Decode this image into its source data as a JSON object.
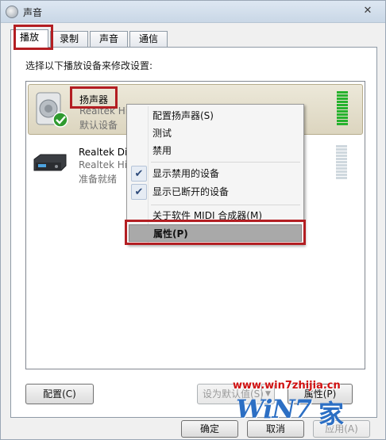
{
  "window": {
    "title": "声音",
    "close_glyph": "✕"
  },
  "tabs": [
    {
      "label": "播放",
      "active": true
    },
    {
      "label": "录制",
      "active": false
    },
    {
      "label": "声音",
      "active": false
    },
    {
      "label": "通信",
      "active": false
    }
  ],
  "instruction": "选择以下播放设备来修改设置:",
  "devices": [
    {
      "name": "扬声器",
      "sub": "Realtek Hi",
      "status": "默认设备",
      "selected": true,
      "icon": "speaker-icon",
      "badge": "default-check-icon",
      "meter": "level-meter"
    },
    {
      "name": "Realtek Di",
      "sub": "Realtek Hi",
      "status": "准备就绪",
      "selected": false,
      "icon": "digital-output-icon"
    }
  ],
  "context_menu": {
    "items": [
      {
        "label": "配置扬声器(S)",
        "checked": false
      },
      {
        "label": "测试",
        "checked": false
      },
      {
        "label": "禁用",
        "checked": false
      },
      {
        "label": "显示禁用的设备",
        "checked": true
      },
      {
        "label": "显示已断开的设备",
        "checked": true
      },
      {
        "label": "关于软件 MIDI 合成器(M)",
        "checked": false
      },
      {
        "label": "属性(P)",
        "checked": false,
        "highlighted": true
      }
    ],
    "check_glyph": "✔"
  },
  "buttons": {
    "configure": "配置(C)",
    "set_default": "设为默认值(S)",
    "set_default_arrow": "▼",
    "properties": "属性(P)",
    "ok": "确定",
    "cancel": "取消",
    "apply": "应用(A)"
  },
  "watermark": {
    "url": "www.win7zhijia.cn",
    "logo": "WiN7",
    "logo2": "家"
  },
  "colors": {
    "highlight_box": "#b31e22",
    "meter_on": "#27b22e",
    "meter_off": "#cfd8de"
  }
}
